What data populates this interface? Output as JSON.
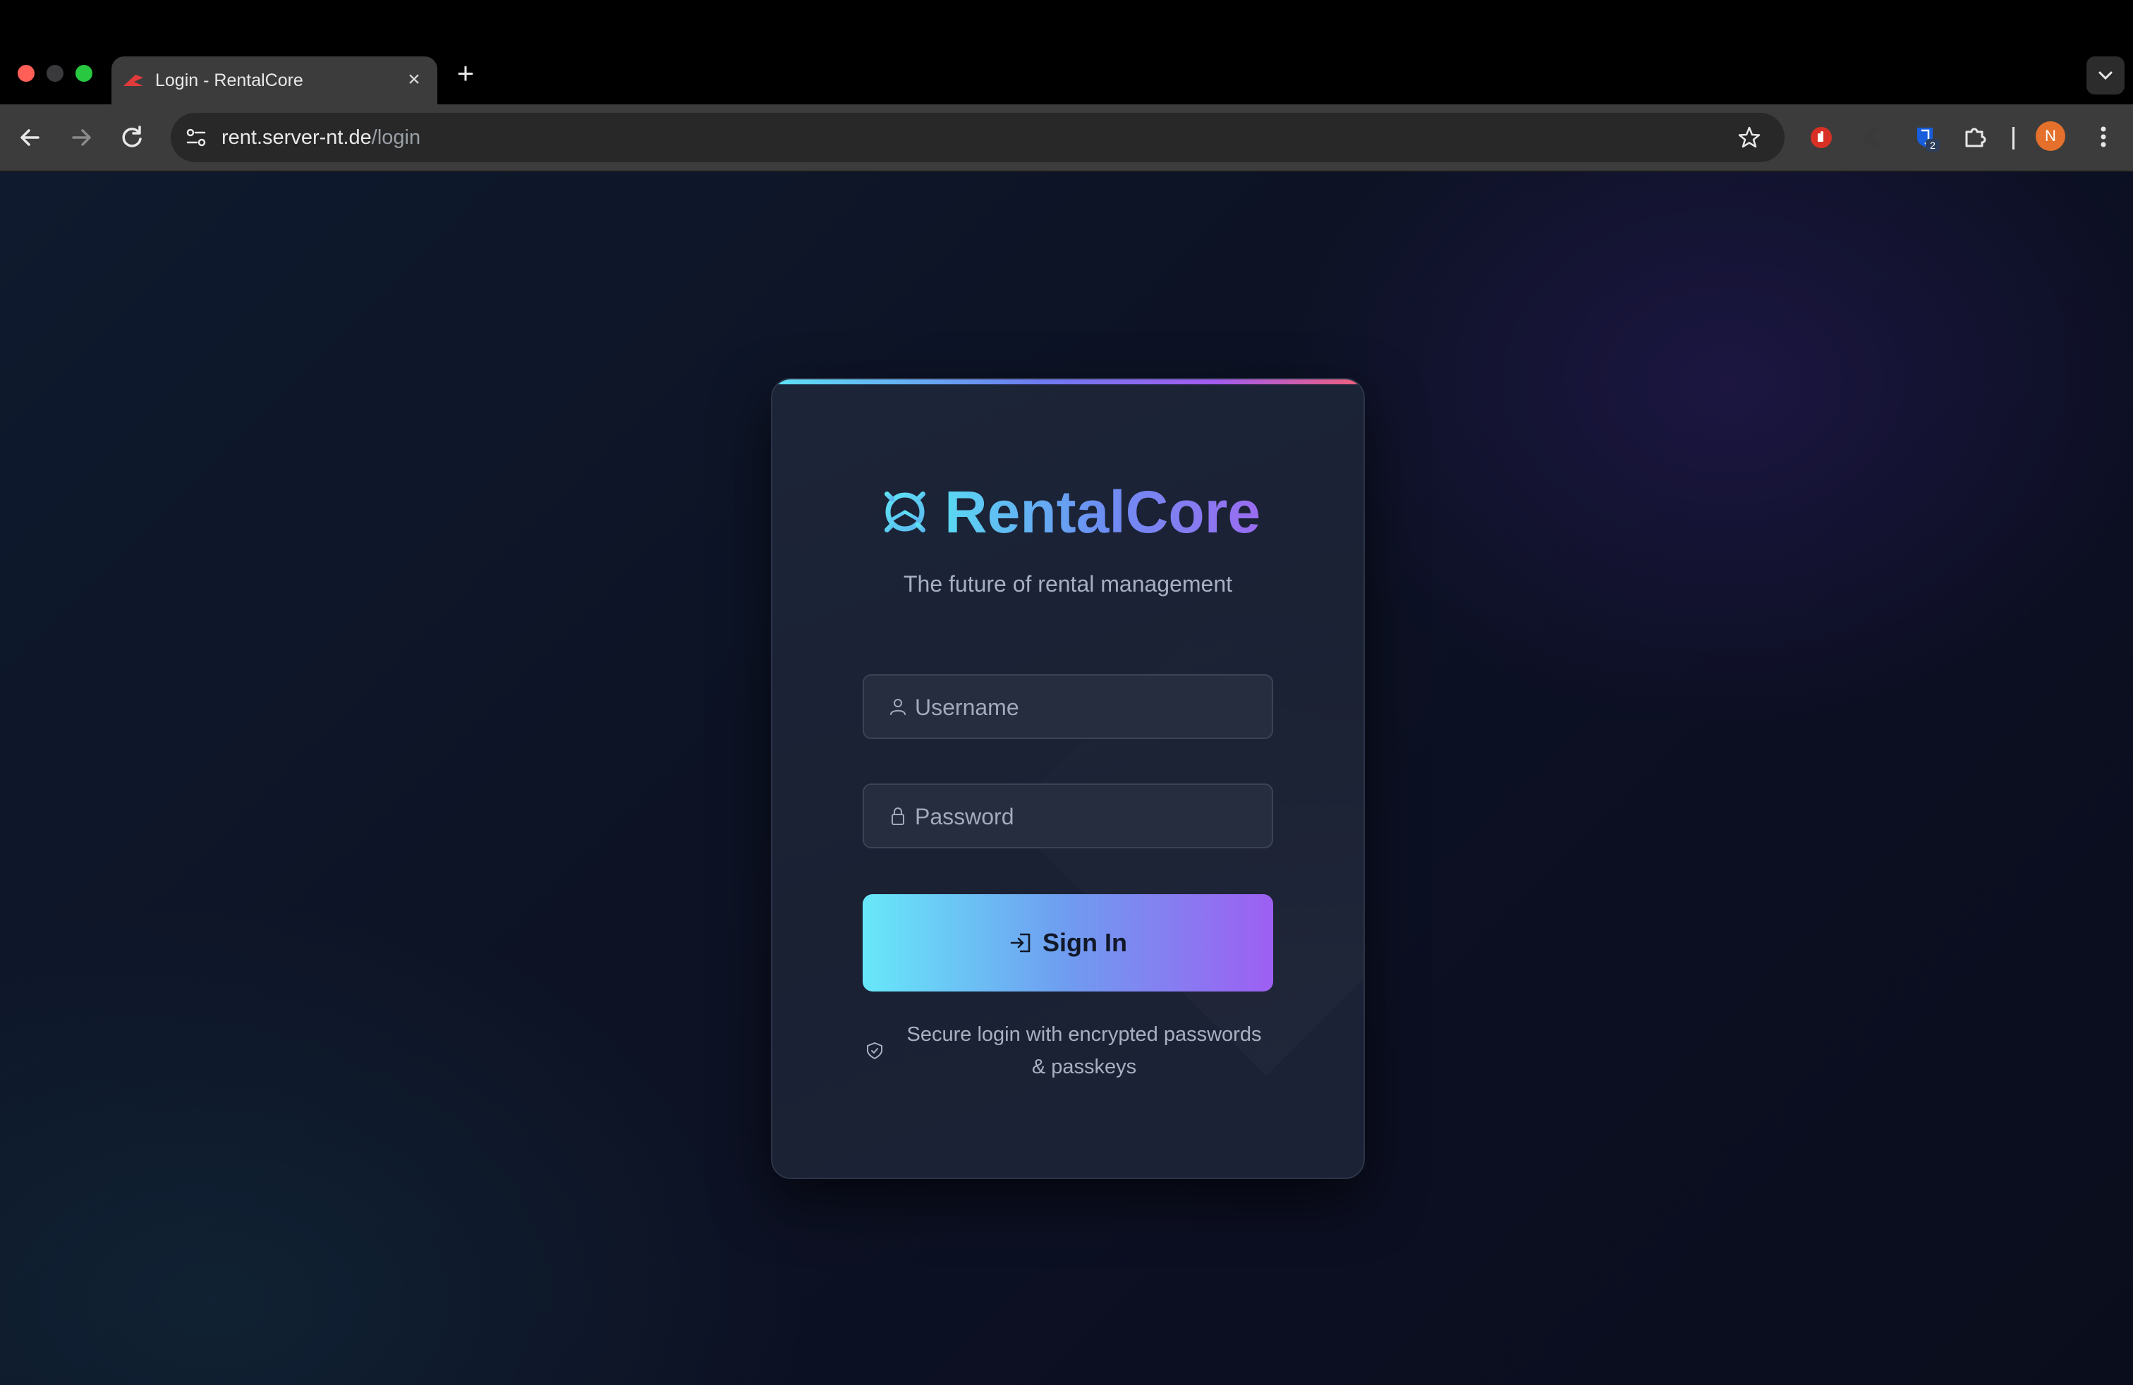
{
  "browser": {
    "tab": {
      "title": "Login - RentalCore"
    },
    "url": {
      "host": "rent.server-nt.de",
      "path": "/login"
    },
    "profile_initial": "N",
    "extension_badge": "2"
  },
  "login": {
    "brand": "RentalCore",
    "tagline": "The future of rental management",
    "username_placeholder": "Username",
    "password_placeholder": "Password",
    "signin_label": "Sign In",
    "secure_note": "Secure login with encrypted passwords & passkeys"
  },
  "colors": {
    "accent_start": "#67e8f9",
    "accent_end": "#9d5ff2",
    "card_bg": "#1c2438",
    "page_bg": "#0d1325"
  },
  "icons": [
    "gear-logo-icon",
    "user-icon",
    "lock-icon",
    "sign-in-icon",
    "shield-check-icon"
  ]
}
